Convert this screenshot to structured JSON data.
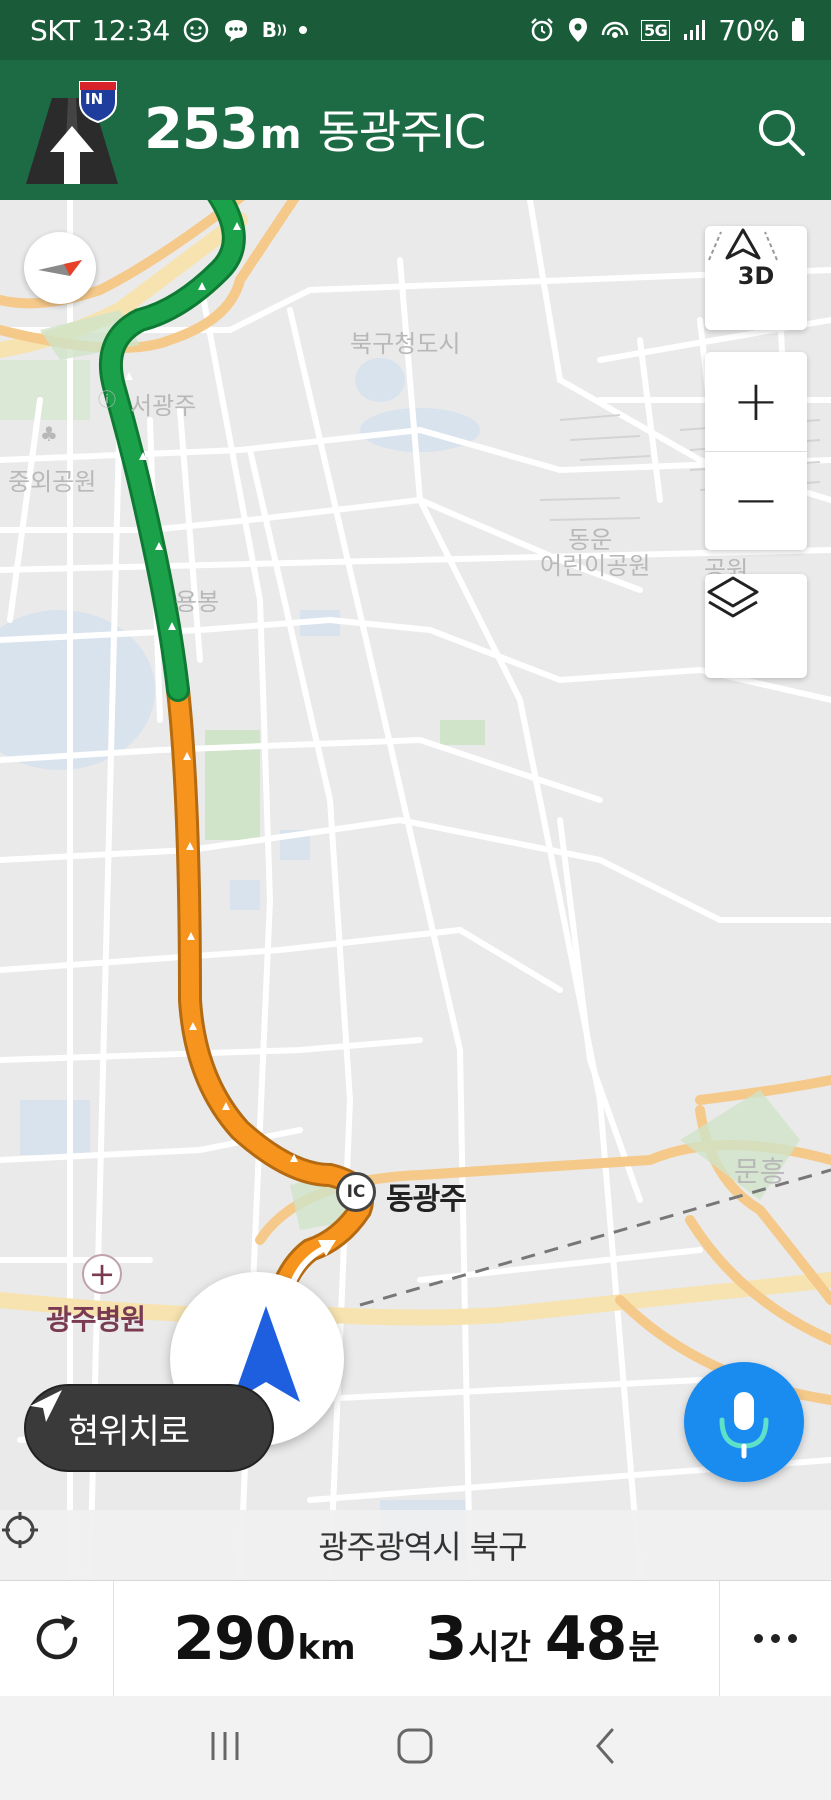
{
  "status_bar": {
    "carrier": "SKT",
    "time": "12:34",
    "network": "5G",
    "battery": "70%",
    "icons": [
      "face-icon",
      "chat-icon",
      "bluetooth-audio-icon",
      "alarm-icon",
      "location-icon",
      "hotspot-icon",
      "signal-icon",
      "battery-icon"
    ]
  },
  "guidance": {
    "distance_value": "253",
    "distance_unit": "m",
    "destination": "동광주IC",
    "sign_text": "IN",
    "colors": {
      "header": "#1d6b44",
      "status": "#1a5c3a"
    }
  },
  "map": {
    "labels": {
      "seogwangju": "서광주",
      "jungoe_park": "중외공원",
      "yongbong": "용봉",
      "bukgu_district": "북구청도시",
      "children_park": "어린이공원",
      "park": "공원",
      "dongwoon": "동운",
      "munheung": "문흥"
    },
    "ic_marker": "IC",
    "ic_name": "동광주",
    "hospital": "광주병원",
    "route_colors": {
      "smooth": "#1aa14a",
      "slow": "#f7941d"
    }
  },
  "controls": {
    "view_mode": "3D",
    "zoom_in": "+",
    "zoom_out": "−"
  },
  "recenter_label": "현위치로",
  "current_location": "광주광역시 북구",
  "trip": {
    "distance_value": "290",
    "distance_unit": "km",
    "hours_value": "3",
    "hours_unit": "시간",
    "minutes_value": "48",
    "minutes_unit": "분"
  }
}
